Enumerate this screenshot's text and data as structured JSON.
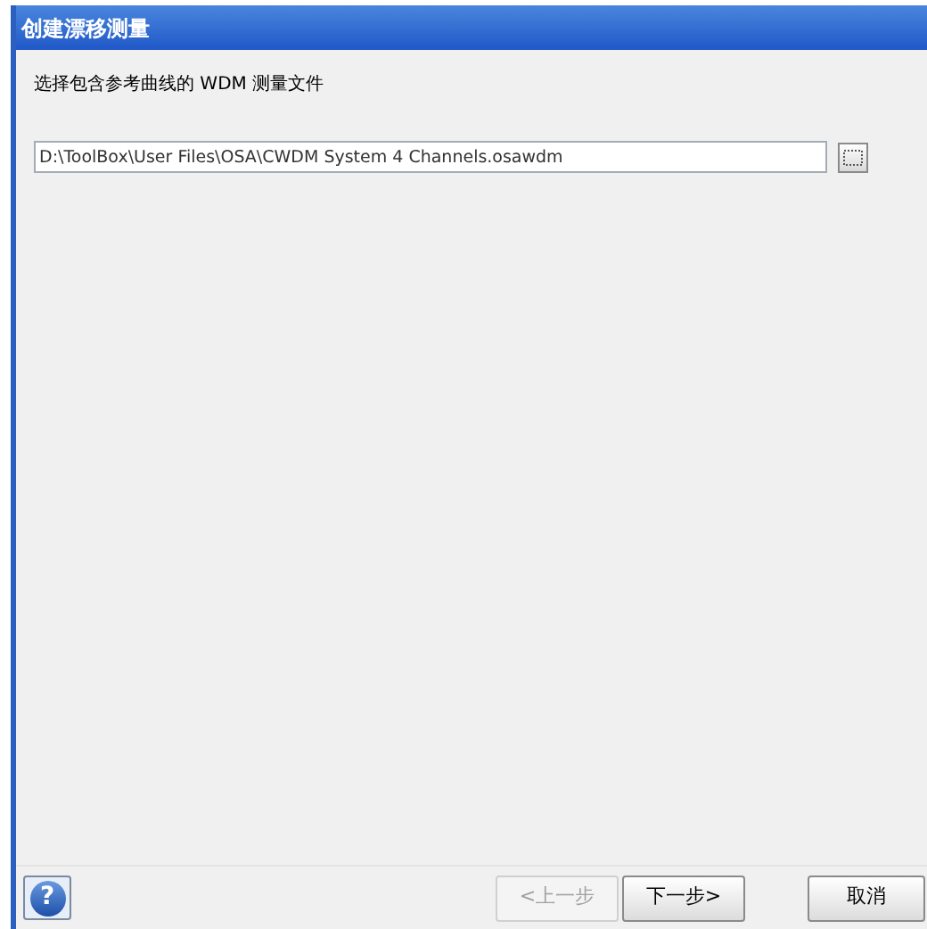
{
  "window": {
    "title": "创建漂移测量"
  },
  "instruction": "选择包含参考曲线的 WDM 测量文件",
  "file_field": {
    "value": "D:\\ToolBox\\User Files\\OSA\\CWDM System 4 Channels.osawdm"
  },
  "help_button": {
    "label": "?"
  },
  "buttons": [
    {
      "label": "<上一步",
      "disabled": true
    },
    {
      "label": "下一步>",
      "disabled": false
    },
    {
      "label": "取消",
      "disabled": false
    }
  ]
}
